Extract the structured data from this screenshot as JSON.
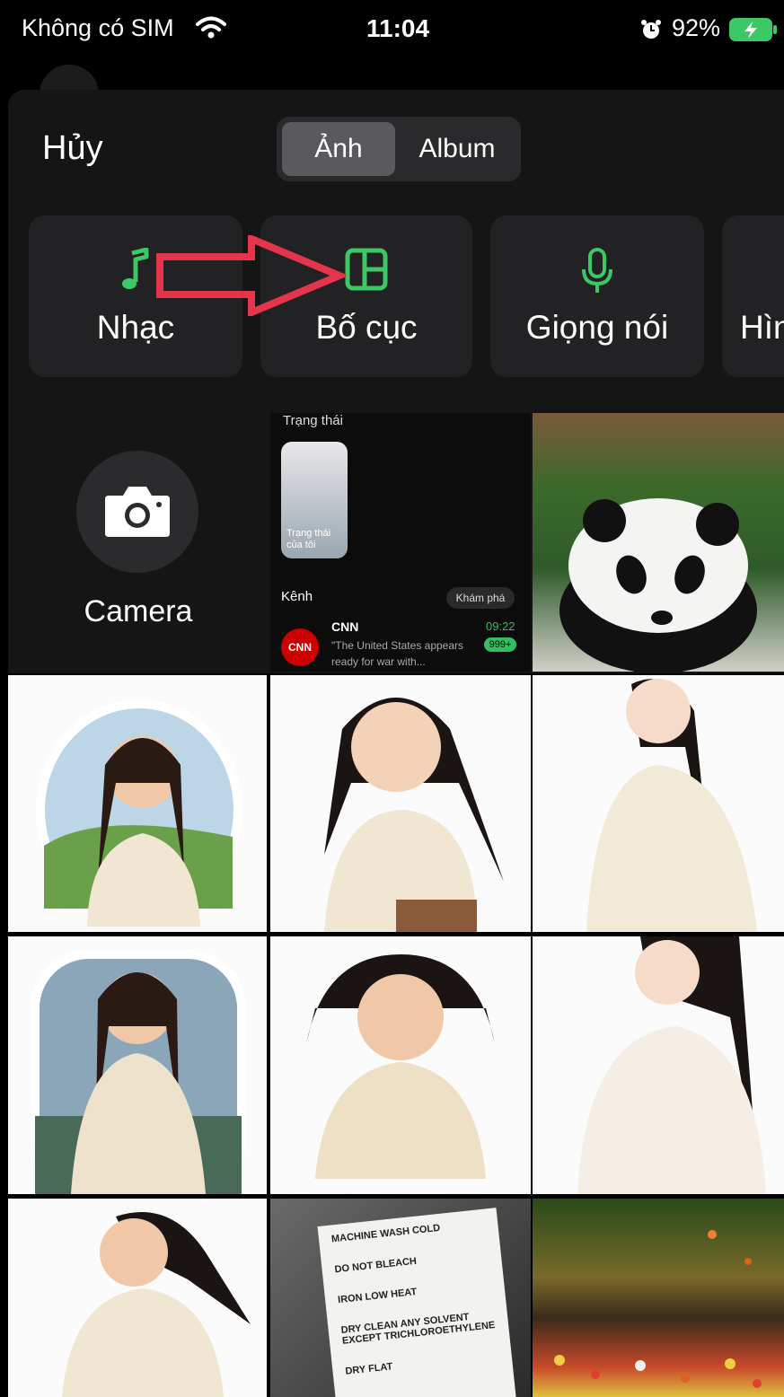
{
  "status_bar": {
    "carrier": "Không có SIM",
    "time": "11:04",
    "battery_percent": "92%"
  },
  "header": {
    "cancel_label": "Hủy",
    "segments": [
      {
        "label": "Ảnh",
        "active": true
      },
      {
        "label": "Album",
        "active": false
      }
    ]
  },
  "attachment_options": [
    {
      "label": "Nhạc",
      "icon": "music-note-icon",
      "color": "#3cc864"
    },
    {
      "label": "Bố cục",
      "icon": "layout-icon",
      "color": "#3cc864"
    },
    {
      "label": "Giọng nói",
      "icon": "microphone-icon",
      "color": "#3cc864"
    },
    {
      "label": "Hìn",
      "icon": "",
      "color": "#3cc864"
    }
  ],
  "camera": {
    "label": "Camera"
  },
  "screenshot_thumb": {
    "section_title": "Trạng thái",
    "my_status": "Trạng thái của tôi",
    "channels_title": "Kênh",
    "explore": "Khám phá",
    "channel_name": "CNN",
    "channel_logo": "CNN",
    "channel_time": "09:22",
    "channel_badge": "999+",
    "channel_message": "\"The United States appears ready for war with..."
  },
  "care_label": {
    "lines": [
      "MACHINE WASH COLD",
      "DO NOT BLEACH",
      "IRON LOW HEAT",
      "DRY CLEAN ANY SOLVENT EXCEPT TRICHLOROETHYLENE",
      "DRY FLAT"
    ]
  },
  "colors": {
    "accent": "#3cc864",
    "arrow": "#e5354a",
    "sheet_bg": "#151515",
    "tile_bg": "#222224"
  }
}
